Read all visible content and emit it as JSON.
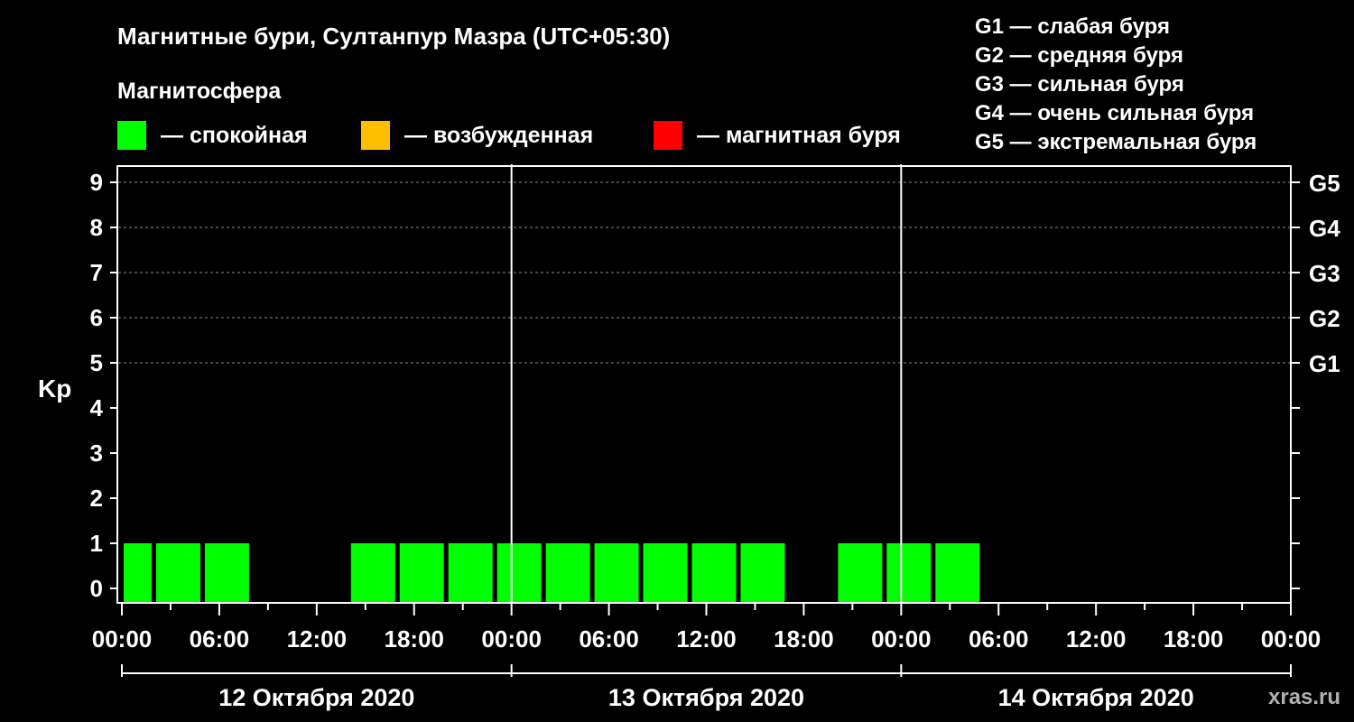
{
  "chart_data": {
    "type": "bar",
    "title": "Магнитные бури, Султанпур Мазра (UTC+05:30)",
    "ylabel": "Kp",
    "ylim": [
      0,
      9
    ],
    "yticks": [
      "0",
      "1",
      "2",
      "3",
      "4",
      "5",
      "6",
      "7",
      "8",
      "9"
    ],
    "storm_levels": [
      {
        "label": "G1",
        "kp": 5
      },
      {
        "label": "G2",
        "kp": 6
      },
      {
        "label": "G3",
        "kp": 7
      },
      {
        "label": "G4",
        "kp": 8
      },
      {
        "label": "G5",
        "kp": 9
      }
    ],
    "xticks": [
      "00:00",
      "06:00",
      "12:00",
      "18:00",
      "00:00",
      "06:00",
      "12:00",
      "18:00",
      "00:00",
      "06:00",
      "12:00",
      "18:00",
      "00:00"
    ],
    "days": [
      "12 Октября 2020",
      "13 Октября 2020",
      "14 Октября 2020"
    ],
    "total_hours": 72,
    "bars": [
      {
        "start_hour": 0,
        "end_hour": 2,
        "kp": 1,
        "level": "quiet"
      },
      {
        "start_hour": 2,
        "end_hour": 5,
        "kp": 1,
        "level": "quiet"
      },
      {
        "start_hour": 5,
        "end_hour": 8,
        "kp": 1,
        "level": "quiet"
      },
      {
        "start_hour": 14,
        "end_hour": 17,
        "kp": 1,
        "level": "quiet"
      },
      {
        "start_hour": 17,
        "end_hour": 20,
        "kp": 1,
        "level": "quiet"
      },
      {
        "start_hour": 20,
        "end_hour": 23,
        "kp": 1,
        "level": "quiet"
      },
      {
        "start_hour": 23,
        "end_hour": 26,
        "kp": 1,
        "level": "quiet"
      },
      {
        "start_hour": 26,
        "end_hour": 29,
        "kp": 1,
        "level": "quiet"
      },
      {
        "start_hour": 29,
        "end_hour": 32,
        "kp": 1,
        "level": "quiet"
      },
      {
        "start_hour": 32,
        "end_hour": 35,
        "kp": 1,
        "level": "quiet"
      },
      {
        "start_hour": 35,
        "end_hour": 38,
        "kp": 1,
        "level": "quiet"
      },
      {
        "start_hour": 38,
        "end_hour": 41,
        "kp": 1,
        "level": "quiet"
      },
      {
        "start_hour": 44,
        "end_hour": 47,
        "kp": 1,
        "level": "quiet"
      },
      {
        "start_hour": 47,
        "end_hour": 50,
        "kp": 1,
        "level": "quiet"
      },
      {
        "start_hour": 50,
        "end_hour": 53,
        "kp": 1,
        "level": "quiet"
      }
    ]
  },
  "legend": {
    "heading": "Магнитосфера",
    "items": [
      {
        "key": "quiet",
        "color": "#00ff00",
        "label": "— спокойная"
      },
      {
        "key": "active",
        "color": "#ffbf00",
        "label": "— возбужденная"
      },
      {
        "key": "storm",
        "color": "#ff0000",
        "label": "— магнитная буря"
      }
    ]
  },
  "g_scale": [
    "G1 — слабая буря",
    "G2 — средняя буря",
    "G3 — сильная буря",
    "G4 — очень сильная буря",
    "G5 — экстремальная буря"
  ],
  "watermark": "xras.ru"
}
